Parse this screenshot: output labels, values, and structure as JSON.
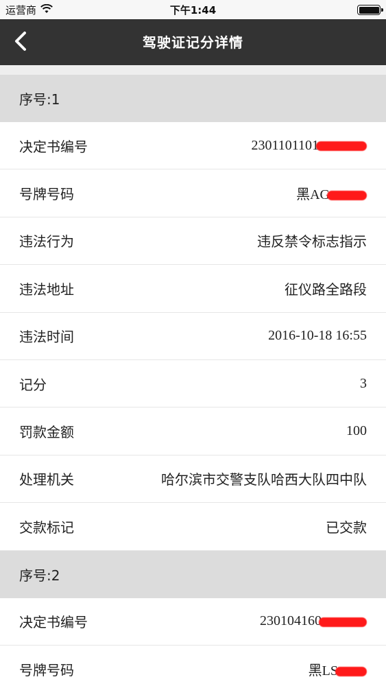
{
  "status": {
    "carrier": "运营商",
    "time": "下午1:44",
    "icons": [
      "wifi-icon",
      "battery-icon"
    ]
  },
  "nav": {
    "title": "驾驶证记分详情",
    "back_icon": "chevron-left-icon"
  },
  "colors": {
    "nav_bg": "#333333",
    "section_bg": "#dcdcdc",
    "redaction": "#ff1a1a"
  },
  "records": [
    {
      "header": "序号:1",
      "fields": [
        {
          "label": "决定书编号",
          "value": "2301101101"
        },
        {
          "label": "号牌号码",
          "value": "黑AG"
        },
        {
          "label": "违法行为",
          "value": "违反禁令标志指示"
        },
        {
          "label": "违法地址",
          "value": "征仪路全路段"
        },
        {
          "label": "违法时间",
          "value": "2016-10-18 16:55"
        },
        {
          "label": "记分",
          "value": "3"
        },
        {
          "label": "罚款金额",
          "value": "100"
        },
        {
          "label": "处理机关",
          "value": "哈尔滨市交警支队哈西大队四中队"
        },
        {
          "label": "交款标记",
          "value": "已交款"
        }
      ]
    },
    {
      "header": "序号:2",
      "fields": [
        {
          "label": "决定书编号",
          "value": "230104160"
        },
        {
          "label": "号牌号码",
          "value": "黑LS"
        }
      ]
    }
  ]
}
